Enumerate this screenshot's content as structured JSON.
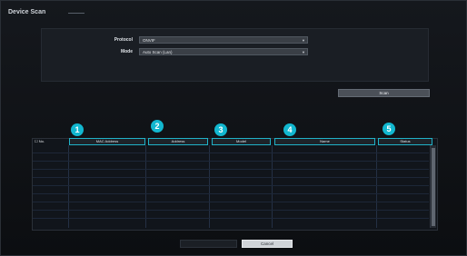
{
  "window": {
    "title": "Device Scan"
  },
  "form": {
    "protocol_label": "Protocol",
    "protocol_value": "ONVIF",
    "mode_label": "Mode",
    "mode_value": "Auto Scan (Lan)"
  },
  "actions": {
    "scan_label": "Scan",
    "left_bottom_label": "",
    "cancel_label": "Cancel"
  },
  "table": {
    "no_label": "No.",
    "columns": [
      "MAC Address",
      "Address",
      "Model",
      "Name",
      "Status"
    ],
    "callouts": [
      "1",
      "2",
      "3",
      "4",
      "5"
    ]
  }
}
